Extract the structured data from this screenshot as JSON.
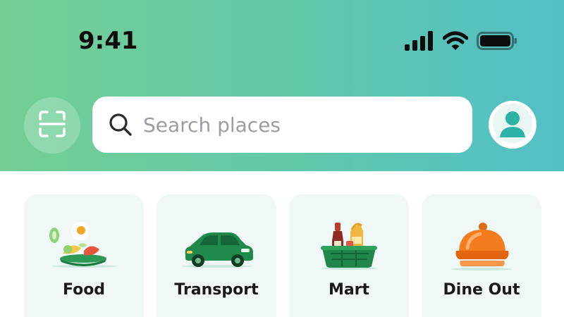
{
  "status_bar": {
    "time": "9:41",
    "icons": [
      "cellular-signal-icon",
      "wifi-icon",
      "battery-icon"
    ]
  },
  "header": {
    "scan_icon": "scan-icon",
    "search": {
      "placeholder": "Search places",
      "value": "",
      "icon": "search-icon"
    },
    "profile_icon": "avatar-icon"
  },
  "categories": [
    {
      "label": "Food",
      "icon": "food-icon"
    },
    {
      "label": "Transport",
      "icon": "car-icon"
    },
    {
      "label": "Mart",
      "icon": "grocery-basket-icon"
    },
    {
      "label": "Dine Out",
      "icon": "cloche-icon"
    }
  ],
  "colors": {
    "header_gradient_start": "#74cf93",
    "header_gradient_end": "#52bfc7",
    "tile_background": "#eff8f6",
    "brand_green": "#16a34a",
    "dine_out_orange": "#f97316"
  }
}
